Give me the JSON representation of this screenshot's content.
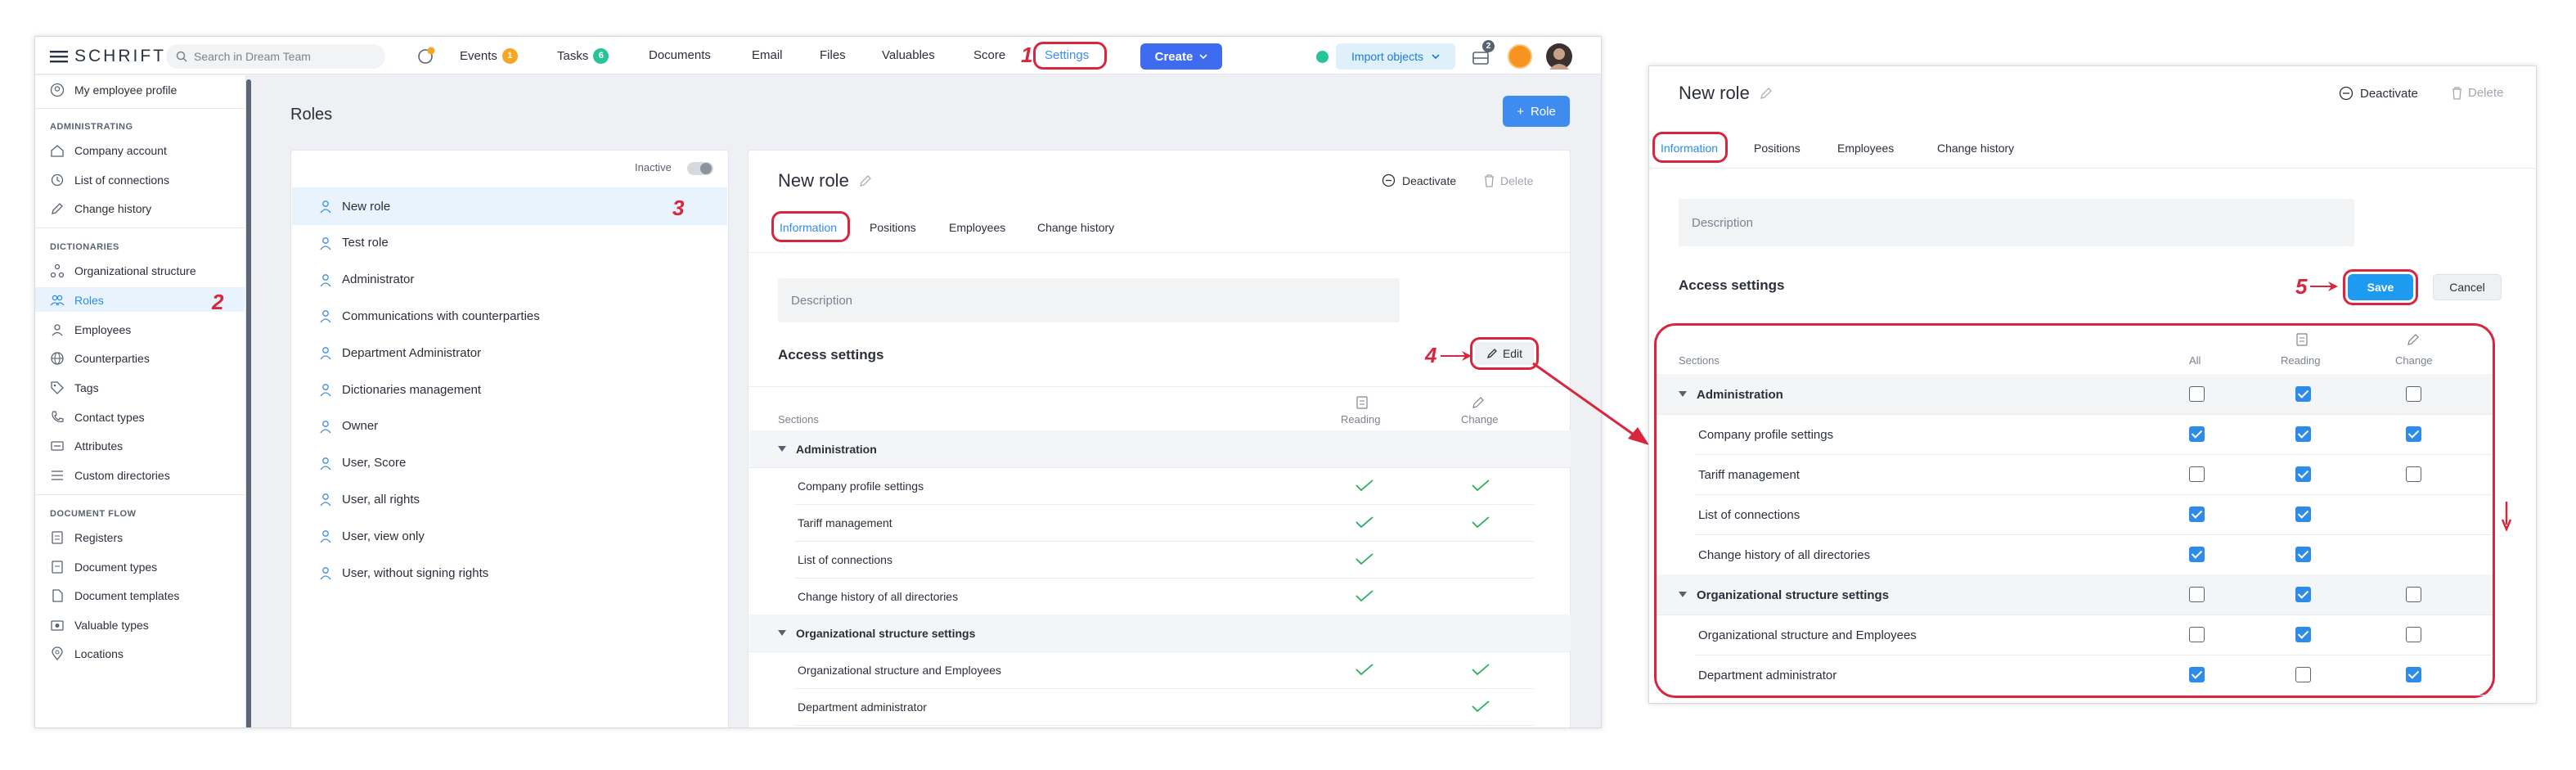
{
  "topbar": {
    "logo": "SCHRIFT",
    "search_placeholder": "Search in Dream Team",
    "nav": [
      {
        "label": "Events",
        "badge": "1",
        "badge_color": "#f5a623"
      },
      {
        "label": "Tasks",
        "badge": "6",
        "badge_color": "#27c49a"
      },
      {
        "label": "Documents"
      },
      {
        "label": "Email"
      },
      {
        "label": "Files"
      },
      {
        "label": "Valuables"
      },
      {
        "label": "Score"
      },
      {
        "label": "Settings"
      }
    ],
    "create_label": "Create",
    "import_label": "Import objects",
    "inbox_badge": "2"
  },
  "sidebar": {
    "my_profile": "My employee profile",
    "sections": [
      {
        "title": "ADMINISTRATING",
        "items": [
          "Company account",
          "List of connections",
          "Change history"
        ]
      },
      {
        "title": "DICTIONARIES",
        "items": [
          "Organizational structure",
          "Roles",
          "Employees",
          "Counterparties",
          "Tags",
          "Contact types",
          "Attributes",
          "Custom directories"
        ]
      },
      {
        "title": "DOCUMENT FLOW",
        "items": [
          "Registers",
          "Document types",
          "Document templates",
          "Valuable types",
          "Locations"
        ]
      }
    ]
  },
  "roles_page": {
    "title": "Roles",
    "add_role_label": "Role",
    "inactive_label": "Inactive",
    "roles": [
      "New role",
      "Test role",
      "Administrator",
      "Communications with counterparties",
      "Department Administrator",
      "Dictionaries management",
      "Owner",
      "User, Score",
      "User, all rights",
      "User, view only",
      "User, without signing rights"
    ]
  },
  "detail": {
    "title": "New role",
    "deactivate_label": "Deactivate",
    "delete_label": "Delete",
    "tabs": [
      "Information",
      "Positions",
      "Employees",
      "Change history"
    ],
    "description_placeholder": "Description",
    "access_title": "Access settings",
    "edit_label": "Edit",
    "col_sections": "Sections",
    "col_all": "All",
    "col_reading": "Reading",
    "col_change": "Change",
    "rows": [
      {
        "label": "Administration",
        "group": true,
        "read": false,
        "change": false
      },
      {
        "label": "Company profile settings",
        "group": false,
        "read": true,
        "change": true
      },
      {
        "label": "Tariff management",
        "group": false,
        "read": true,
        "change": true
      },
      {
        "label": "List of connections",
        "group": false,
        "read": true,
        "change": false
      },
      {
        "label": "Change history of all directories",
        "group": false,
        "read": true,
        "change": false
      },
      {
        "label": "Organizational structure settings",
        "group": true,
        "read": false,
        "change": false
      },
      {
        "label": "Organizational structure and Employees",
        "group": false,
        "read": true,
        "change": true
      },
      {
        "label": "Department administrator",
        "group": false,
        "read": false,
        "change": true
      }
    ]
  },
  "edit_panel": {
    "save_label": "Save",
    "cancel_label": "Cancel",
    "rows": [
      {
        "all": false,
        "read": true,
        "change": false
      },
      {
        "all": true,
        "read": true,
        "change": true
      },
      {
        "all": false,
        "read": true,
        "change": false
      },
      {
        "all": true,
        "read": true,
        "change": null
      },
      {
        "all": true,
        "read": true,
        "change": null
      },
      {
        "all": false,
        "read": true,
        "change": false
      },
      {
        "all": false,
        "read": true,
        "change": false
      },
      {
        "all": true,
        "read": false,
        "change": true
      }
    ]
  },
  "annotations": [
    "1",
    "2",
    "3",
    "4",
    "5"
  ],
  "colors": {
    "accent": "#3f8cf0",
    "annotation": "#d7263d",
    "check": "#27ae60",
    "checkbox": "#2e8be8"
  }
}
